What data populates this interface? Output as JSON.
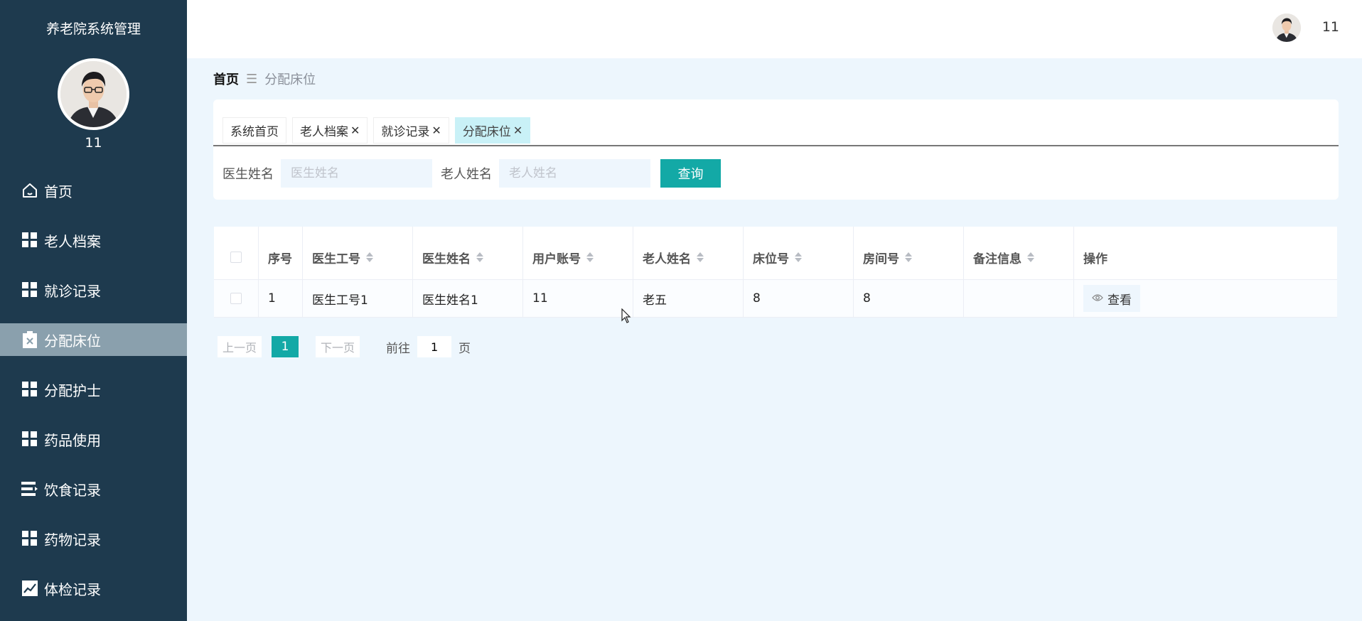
{
  "sidebar": {
    "title": "养老院系统管理",
    "user_name": "11",
    "items": [
      {
        "label": "首页",
        "icon": "home-icon"
      },
      {
        "label": "老人档案",
        "icon": "grid-icon"
      },
      {
        "label": "就诊记录",
        "icon": "grid-icon"
      },
      {
        "label": "分配床位",
        "icon": "clipboard-icon",
        "active": true
      },
      {
        "label": "分配护士",
        "icon": "grid-icon"
      },
      {
        "label": "药品使用",
        "icon": "grid-icon"
      },
      {
        "label": "饮食记录",
        "icon": "list-icon"
      },
      {
        "label": "药物记录",
        "icon": "grid-icon"
      },
      {
        "label": "体检记录",
        "icon": "chart-icon"
      }
    ]
  },
  "header": {
    "user_name": "11"
  },
  "breadcrumb": {
    "home": "首页",
    "separator": "☰",
    "current": "分配床位"
  },
  "tabs": [
    {
      "label": "系统首页",
      "closable": false
    },
    {
      "label": "老人档案",
      "closable": true
    },
    {
      "label": "就诊记录",
      "closable": true
    },
    {
      "label": "分配床位",
      "closable": true,
      "active": true
    }
  ],
  "search": {
    "doctor_label": "医生姓名",
    "doctor_placeholder": "医生姓名",
    "elder_label": "老人姓名",
    "elder_placeholder": "老人姓名",
    "query_button": "查询"
  },
  "table": {
    "columns": [
      "序号",
      "医生工号",
      "医生姓名",
      "用户账号",
      "老人姓名",
      "床位号",
      "房间号",
      "备注信息",
      "操作"
    ],
    "rows": [
      {
        "index": "1",
        "doctor_no": "医生工号1",
        "doctor_name": "医生姓名1",
        "account": "11",
        "elder_name": "老五",
        "bed_no": "8",
        "room_no": "8",
        "remark": "",
        "action": "查看"
      }
    ]
  },
  "pagination": {
    "prev": "上一页",
    "current": "1",
    "next": "下一页",
    "goto_label": "前往",
    "goto_value": "1",
    "page_suffix": "页"
  },
  "colors": {
    "sidebar_bg": "#1e3a4e",
    "sidebar_active": "#8aa0ad",
    "accent": "#13a9a6",
    "page_bg": "#edf6fd",
    "active_tab": "#c9f1f7"
  }
}
